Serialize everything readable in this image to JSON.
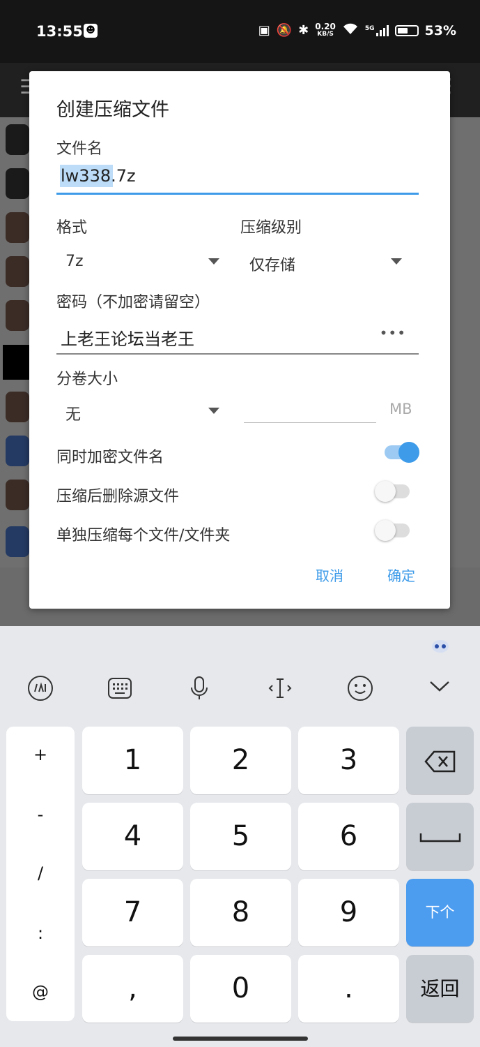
{
  "status_bar": {
    "time": "13:55",
    "net_speed_value": "0.20",
    "net_speed_unit": "KB/S",
    "signal_label": "5G",
    "battery": "53%"
  },
  "dialog": {
    "title": "创建压缩文件",
    "filename_label": "文件名",
    "filename_value": "lw338.7z",
    "format_label": "格式",
    "format_value": "7z",
    "level_label": "压缩级别",
    "level_value": "仅存储",
    "password_label": "密码（不加密请留空）",
    "password_value": "上老王论坛当老王",
    "password_toggle": "•••",
    "split_label": "分卷大小",
    "split_value": "无",
    "split_unit": "MB",
    "encrypt_names_label": "同时加密文件名",
    "encrypt_names_on": true,
    "delete_source_label": "压缩后删除源文件",
    "delete_source_on": false,
    "separate_label": "单独压缩每个文件/文件夹",
    "separate_on": false,
    "cancel_label": "取消",
    "ok_label": "确定"
  },
  "keyboard": {
    "symbols": [
      "+",
      "-",
      "/",
      ":",
      "@"
    ],
    "digits": [
      "1",
      "2",
      "3",
      "4",
      "5",
      "6",
      "7",
      "8",
      "9"
    ],
    "comma": ",",
    "zero": "0",
    "dot": ".",
    "next_label": "下个",
    "return_label": "返回"
  },
  "colors": {
    "accent": "#3d9be9",
    "keyboard_bg": "#e6e8ec",
    "next_key": "#4c9cf0"
  }
}
